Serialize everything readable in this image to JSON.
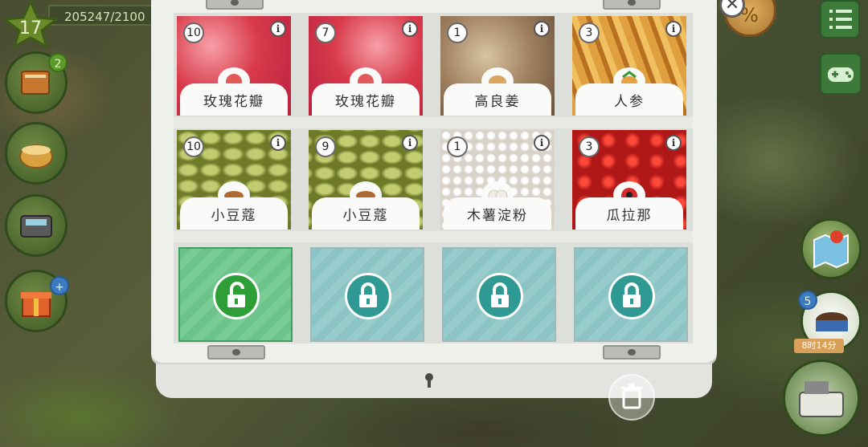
{
  "hud": {
    "level": "17",
    "xp": "205247/2100",
    "journal_badge": "2",
    "shop_badge": "5",
    "timer": "8时14分"
  },
  "items": [
    {
      "name": "玫瑰花瓣",
      "count": "10",
      "icon": "rose-petal-icon",
      "color": "#d83a4a"
    },
    {
      "name": "玫瑰花瓣",
      "count": "7",
      "icon": "rose-petal-icon",
      "color": "#d83a4a"
    },
    {
      "name": "高良姜",
      "count": "1",
      "icon": "galangal-icon",
      "color": "#a08060"
    },
    {
      "name": "人参",
      "count": "3",
      "icon": "ginseng-icon",
      "color": "#c88a30"
    },
    {
      "name": "小豆蔻",
      "count": "10",
      "icon": "cardamom-icon",
      "color": "#9aa840"
    },
    {
      "name": "小豆蔻",
      "count": "9",
      "icon": "cardamom-icon",
      "color": "#9aa840"
    },
    {
      "name": "木薯淀粉",
      "count": "1",
      "icon": "tapioca-icon",
      "color": "#f0ece4"
    },
    {
      "name": "瓜拉那",
      "count": "3",
      "icon": "guarana-icon",
      "color": "#c0282a"
    }
  ],
  "locks": [
    {
      "state": "unlocked",
      "icon": "unlocked-padlock-icon"
    },
    {
      "state": "locked",
      "icon": "padlock-icon"
    },
    {
      "state": "locked",
      "icon": "padlock-icon"
    },
    {
      "state": "locked",
      "icon": "padlock-icon"
    }
  ],
  "info_glyph": "i",
  "close_glyph": "✕"
}
